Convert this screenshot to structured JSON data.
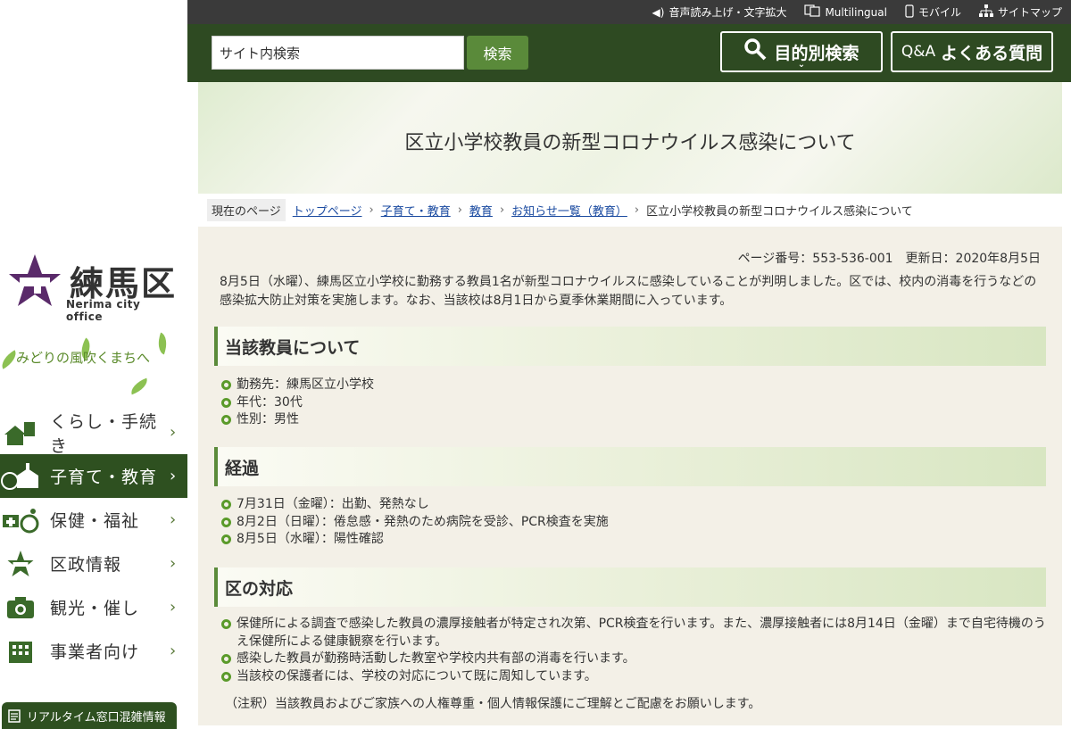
{
  "sidebar": {
    "logo_text": "練馬区",
    "logo_sub": "Nerima city office",
    "slogan": "みどりの風吹くまちへ",
    "nav": [
      {
        "label": "くらし・手続き",
        "icon": "house-doc-icon",
        "active": false
      },
      {
        "label": "子育て・教育",
        "icon": "school-icon",
        "active": true
      },
      {
        "label": "保健・福祉",
        "icon": "wheelchair-icon",
        "active": false
      },
      {
        "label": "区政情報",
        "icon": "city-emblem-icon",
        "active": false
      },
      {
        "label": "観光・催し",
        "icon": "camera-icon",
        "active": false
      },
      {
        "label": "事業者向け",
        "icon": "building-icon",
        "active": false
      }
    ],
    "realtime_label": "リアルタイム窓口混雑情報"
  },
  "topbar": {
    "items": [
      {
        "label": "音声読み上げ・文字拡大",
        "icon": "speaker-icon"
      },
      {
        "label": "Multilingual",
        "icon": "translate-icon"
      },
      {
        "label": "モバイル",
        "icon": "mobile-icon"
      },
      {
        "label": "サイトマップ",
        "icon": "sitemap-icon"
      }
    ]
  },
  "header": {
    "search_value": "サイト内検索",
    "search_button": "検索",
    "purpose_search": "目的別検索",
    "faq_prefix": "Q&A",
    "faq_label": "よくある質問"
  },
  "page": {
    "title": "区立小学校教員の新型コロナウイルス感染について",
    "breadcrumb_label": "現在のページ",
    "breadcrumb": [
      "トップページ",
      "子育て・教育",
      "教育",
      "お知らせ一覧（教育）"
    ],
    "breadcrumb_current": "区立小学校教員の新型コロナウイルス感染について",
    "meta": "ページ番号：553-536-001　更新日：2020年8月5日",
    "intro": "8月5日（水曜）、練馬区立小学校に勤務する教員1名が新型コロナウイルスに感染していることが判明しました。区では、校内の消毒を行うなどの感染拡大防止対策を実施します。なお、当該校は8月1日から夏季休業期間に入っています。",
    "sections": [
      {
        "heading": "当該教員について",
        "items": [
          "勤務先：練馬区立小学校",
          "年代：30代",
          "性別：男性"
        ]
      },
      {
        "heading": "経過",
        "items": [
          "7月31日（金曜）：出勤、発熱なし",
          "8月2日（日曜）：倦怠感・発熱のため病院を受診、PCR検査を実施",
          "8月5日（水曜）：陽性確認"
        ]
      },
      {
        "heading": "区の対応",
        "items": [
          "保健所による調査で感染した教員の濃厚接触者が特定され次第、PCR検査を行います。また、濃厚接触者には8月14日（金曜）まで自宅待機のうえ保健所による健康観察を行います。",
          "感染した教員が勤務時活動した教室や学校内共有部の消毒を行います。",
          "当該校の保護者には、学校の対応について既に周知しています。"
        ]
      }
    ],
    "note": "（注釈）当該教員およびご家族への人権尊重・個人情報保護にご理解とご配慮をお願いします。"
  },
  "colors": {
    "header_green": "#2e4a22",
    "accent_green": "#5a8a3a",
    "link_blue": "#1a4aa0",
    "content_bg": "#f3f0e7"
  }
}
